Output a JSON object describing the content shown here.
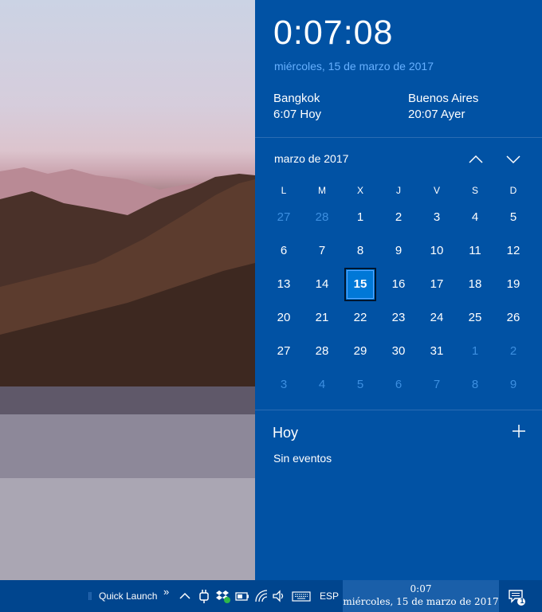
{
  "flyout": {
    "time": "0:07:08",
    "date": "miércoles, 15 de marzo de 2017",
    "clocks": [
      {
        "city": "Bangkok",
        "time": "6:07 Hoy"
      },
      {
        "city": "Buenos Aires",
        "time": "20:07 Ayer"
      }
    ]
  },
  "calendar": {
    "month_title": "marzo de 2017",
    "weekdays": [
      "L",
      "M",
      "X",
      "J",
      "V",
      "S",
      "D"
    ],
    "weeks": [
      [
        {
          "d": "27",
          "dim": true
        },
        {
          "d": "28",
          "dim": true
        },
        {
          "d": "1"
        },
        {
          "d": "2"
        },
        {
          "d": "3"
        },
        {
          "d": "4"
        },
        {
          "d": "5"
        }
      ],
      [
        {
          "d": "6"
        },
        {
          "d": "7"
        },
        {
          "d": "8"
        },
        {
          "d": "9"
        },
        {
          "d": "10"
        },
        {
          "d": "11"
        },
        {
          "d": "12"
        }
      ],
      [
        {
          "d": "13"
        },
        {
          "d": "14"
        },
        {
          "d": "15",
          "today": true
        },
        {
          "d": "16"
        },
        {
          "d": "17"
        },
        {
          "d": "18"
        },
        {
          "d": "19"
        }
      ],
      [
        {
          "d": "20"
        },
        {
          "d": "21"
        },
        {
          "d": "22"
        },
        {
          "d": "23"
        },
        {
          "d": "24"
        },
        {
          "d": "25"
        },
        {
          "d": "26"
        }
      ],
      [
        {
          "d": "27"
        },
        {
          "d": "28"
        },
        {
          "d": "29"
        },
        {
          "d": "30"
        },
        {
          "d": "31"
        },
        {
          "d": "1",
          "dim": true
        },
        {
          "d": "2",
          "dim": true
        }
      ],
      [
        {
          "d": "3",
          "dim": true
        },
        {
          "d": "4",
          "dim": true
        },
        {
          "d": "5",
          "dim": true
        },
        {
          "d": "6",
          "dim": true
        },
        {
          "d": "7",
          "dim": true
        },
        {
          "d": "8",
          "dim": true
        },
        {
          "d": "9",
          "dim": true
        }
      ]
    ]
  },
  "agenda": {
    "title": "Hoy",
    "empty": "Sin eventos"
  },
  "taskbar": {
    "quick_launch": "Quick Launch",
    "chevron": "»",
    "language": "ESP",
    "clock_time": "0:07",
    "clock_date": "miércoles, 15 de marzo de 2017",
    "notification_count": "1"
  },
  "colors": {
    "flyout_bg": "#0152a4",
    "today_bg": "#0078d7",
    "date_accent": "#66b0ff",
    "taskbar_bg": "#00458e"
  }
}
